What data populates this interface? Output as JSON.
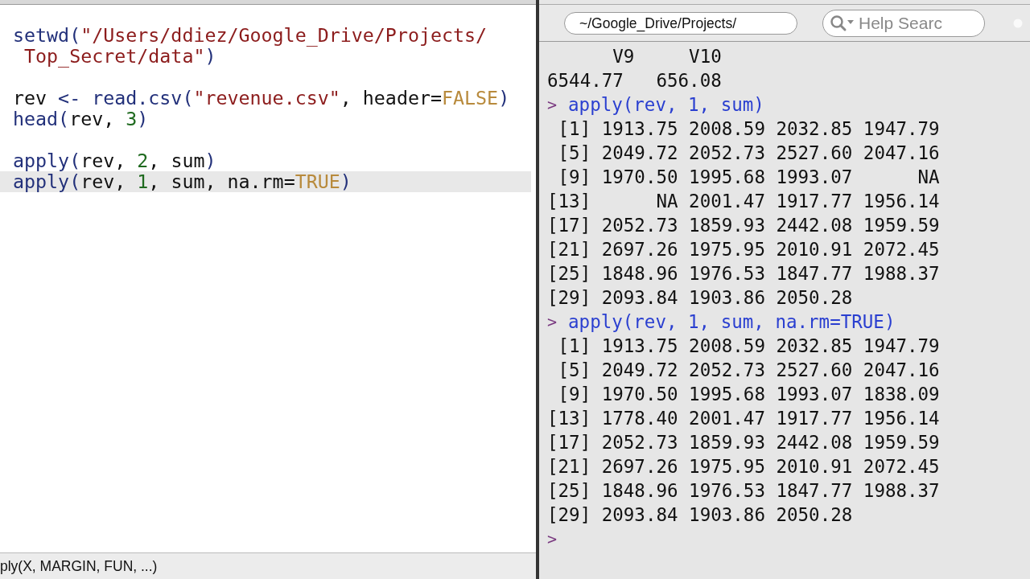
{
  "editor": {
    "lines": [
      {
        "kind": "code",
        "highlighted": false,
        "tokens": [
          {
            "kind": "fn",
            "text": "setwd("
          },
          {
            "kind": "str",
            "text": "\"/Users/ddiez/Google_Drive/Projects/"
          }
        ]
      },
      {
        "kind": "code",
        "highlighted": false,
        "tokens": [
          {
            "kind": "str",
            "text": " Top_Secret/data\""
          },
          {
            "kind": "fn",
            "text": ")"
          }
        ]
      },
      {
        "kind": "blank"
      },
      {
        "kind": "code",
        "highlighted": false,
        "tokens": [
          {
            "kind": "plain",
            "text": "rev "
          },
          {
            "kind": "fn",
            "text": "<- read.csv("
          },
          {
            "kind": "str",
            "text": "\"revenue.csv\""
          },
          {
            "kind": "plain",
            "text": ", header="
          },
          {
            "kind": "const",
            "text": "FALSE"
          },
          {
            "kind": "fn",
            "text": ")"
          }
        ]
      },
      {
        "kind": "code",
        "highlighted": false,
        "tokens": [
          {
            "kind": "fn",
            "text": "head("
          },
          {
            "kind": "plain",
            "text": "rev, "
          },
          {
            "kind": "num",
            "text": "3"
          },
          {
            "kind": "fn",
            "text": ")"
          }
        ]
      },
      {
        "kind": "blank"
      },
      {
        "kind": "code",
        "highlighted": false,
        "tokens": [
          {
            "kind": "fn",
            "text": "apply("
          },
          {
            "kind": "plain",
            "text": "rev, "
          },
          {
            "kind": "num",
            "text": "2"
          },
          {
            "kind": "plain",
            "text": ", sum"
          },
          {
            "kind": "fn",
            "text": ")"
          }
        ]
      },
      {
        "kind": "code",
        "highlighted": true,
        "tokens": [
          {
            "kind": "fn",
            "text": "apply("
          },
          {
            "kind": "plain",
            "text": "rev, "
          },
          {
            "kind": "num",
            "text": "1"
          },
          {
            "kind": "plain",
            "text": ", sum, na.rm="
          },
          {
            "kind": "const",
            "text": "TRUE"
          },
          {
            "kind": "fn",
            "text": ")"
          }
        ]
      }
    ]
  },
  "status_bar": {
    "text": "ply(X, MARGIN, FUN, ...)"
  },
  "toolbar": {
    "path": "~/Google_Drive/Projects/",
    "search": {
      "placeholder": "Help Searc"
    }
  },
  "console": {
    "lines": [
      {
        "kind": "output",
        "text": "      V9     V10"
      },
      {
        "kind": "output",
        "text": "6544.77   656.08"
      },
      {
        "kind": "command",
        "prompt": ">",
        "text": "apply(rev, 1, sum)"
      },
      {
        "kind": "output",
        "text": " [1] 1913.75 2008.59 2032.85 1947.79"
      },
      {
        "kind": "output",
        "text": " [5] 2049.72 2052.73 2527.60 2047.16"
      },
      {
        "kind": "output",
        "text": " [9] 1970.50 1995.68 1993.07      NA"
      },
      {
        "kind": "output",
        "text": "[13]      NA 2001.47 1917.77 1956.14"
      },
      {
        "kind": "output",
        "text": "[17] 2052.73 1859.93 2442.08 1959.59"
      },
      {
        "kind": "output",
        "text": "[21] 2697.26 1975.95 2010.91 2072.45"
      },
      {
        "kind": "output",
        "text": "[25] 1848.96 1976.53 1847.77 1988.37"
      },
      {
        "kind": "output",
        "text": "[29] 2093.84 1903.86 2050.28"
      },
      {
        "kind": "command",
        "prompt": ">",
        "text": "apply(rev, 1, sum, na.rm=TRUE)"
      },
      {
        "kind": "output",
        "text": " [1] 1913.75 2008.59 2032.85 1947.79"
      },
      {
        "kind": "output",
        "text": " [5] 2049.72 2052.73 2527.60 2047.16"
      },
      {
        "kind": "output",
        "text": " [9] 1970.50 1995.68 1993.07 1838.09"
      },
      {
        "kind": "output",
        "text": "[13] 1778.40 2001.47 1917.77 1956.14"
      },
      {
        "kind": "output",
        "text": "[17] 2052.73 1859.93 2442.08 1959.59"
      },
      {
        "kind": "output",
        "text": "[21] 2697.26 1975.95 2010.91 2072.45"
      },
      {
        "kind": "output",
        "text": "[25] 1848.96 1976.53 1847.77 1988.37"
      },
      {
        "kind": "output",
        "text": "[29] 2093.84 1903.86 2050.28"
      },
      {
        "kind": "input",
        "prompt": ">"
      }
    ]
  }
}
